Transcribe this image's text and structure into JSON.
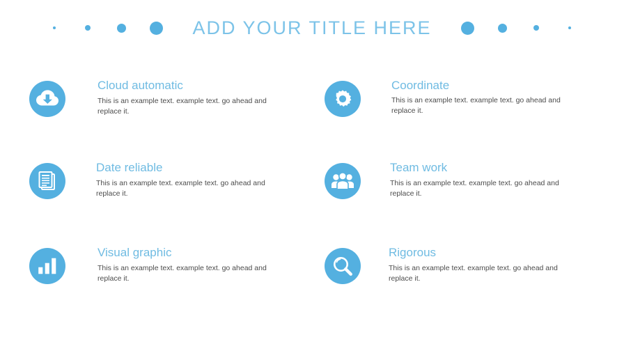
{
  "header": {
    "title": "ADD YOUR TITLE HERE",
    "title_color": "#7cc3e8",
    "dots_left": [
      {
        "name": "dot-1",
        "size": 4
      },
      {
        "name": "dot-2",
        "size": 8
      },
      {
        "name": "dot-3",
        "size": 13
      },
      {
        "name": "dot-4",
        "size": 19
      }
    ],
    "dots_right": [
      {
        "name": "dot-5",
        "size": 19
      },
      {
        "name": "dot-6",
        "size": 13
      },
      {
        "name": "dot-7",
        "size": 8
      },
      {
        "name": "dot-8",
        "size": 4
      }
    ],
    "dot_color": "#54b0e0"
  },
  "theme": {
    "accent": "#54b0e0",
    "heading": "#6fbbe2",
    "body_text": "#4c4c4c",
    "background": "#ffffff"
  },
  "features": [
    {
      "icon": "cloud-download-icon",
      "title": "Cloud automatic",
      "desc": "This is an example text. example text. go ahead and replace it."
    },
    {
      "icon": "gear-icon",
      "title": "Coordinate",
      "desc": "This is an example text. example text. go ahead and replace it."
    },
    {
      "icon": "documents-icon",
      "title": "Date reliable",
      "desc": "This is an example text. example text. go ahead and replace it."
    },
    {
      "icon": "people-group-icon",
      "title": "Team work",
      "desc": "This is an example text. example text. go ahead and replace it."
    },
    {
      "icon": "bar-chart-icon",
      "title": "Visual graphic",
      "desc": "This is an example text. example text. go ahead and replace it."
    },
    {
      "icon": "magnifier-icon",
      "title": "Rigorous",
      "desc": "This is an example text. example text. go ahead and replace it."
    }
  ]
}
